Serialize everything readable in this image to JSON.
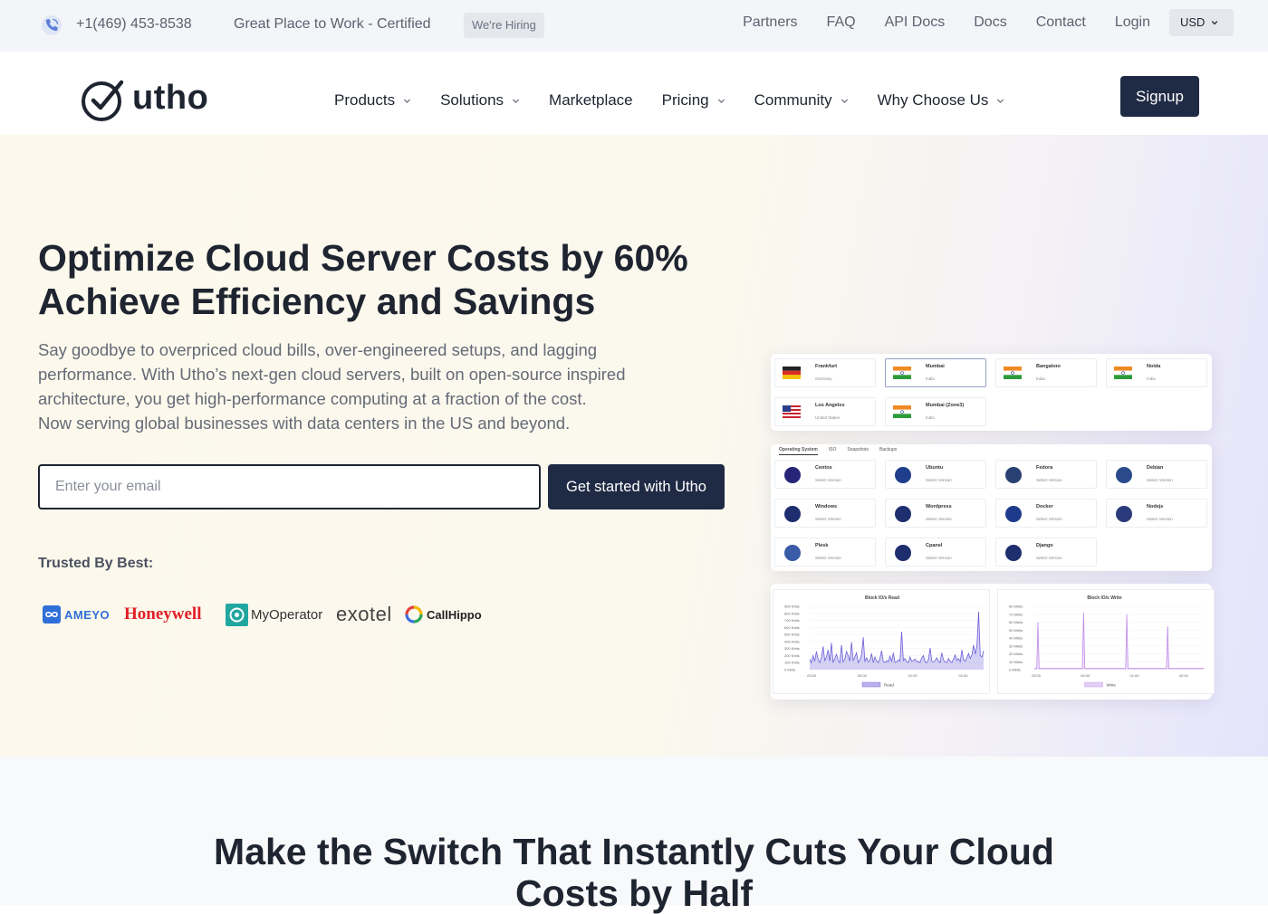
{
  "topbar": {
    "phone": "+1(469) 453-8538",
    "certification": "Great Place to Work - Certified",
    "hiring_badge": "We're Hiring",
    "links": [
      "Partners",
      "FAQ",
      "API Docs",
      "Docs",
      "Contact",
      "Login"
    ],
    "currency": "USD"
  },
  "nav": {
    "logo": "utho",
    "menu": [
      {
        "label": "Products",
        "dropdown": true
      },
      {
        "label": "Solutions",
        "dropdown": true
      },
      {
        "label": "Marketplace",
        "dropdown": false
      },
      {
        "label": "Pricing",
        "dropdown": true
      },
      {
        "label": "Community",
        "dropdown": true
      },
      {
        "label": "Why Choose Us",
        "dropdown": true
      }
    ],
    "signup": "Signup"
  },
  "hero": {
    "title_line1": "Optimize Cloud Server Costs by 60%",
    "title_line2": "Achieve Efficiency and Savings",
    "lead_line1": "Say goodbye to overpriced cloud bills, over-engineered setups, and lagging",
    "lead_line2": "performance. With Utho’s next-gen cloud servers, built on open-source inspired",
    "lead_line3": "architecture, you get high-performance computing at a fraction of the cost.",
    "lead_line4": "Now serving global businesses with data centers in the US and beyond.",
    "email_placeholder": "Enter your email",
    "cta": "Get started with Utho",
    "trusted": "Trusted By Best:",
    "brands": [
      "AMEYO",
      "Honeywell",
      "MyOperator",
      "exotel",
      "CallHippo"
    ]
  },
  "preview": {
    "locations": [
      {
        "city": "Frankfurt",
        "country": "Germany",
        "flag": "de"
      },
      {
        "city": "Mumbai",
        "country": "India",
        "flag": "in",
        "selected": true
      },
      {
        "city": "Bangalore",
        "country": "India",
        "flag": "in"
      },
      {
        "city": "Noida",
        "country": "India",
        "flag": "in"
      },
      {
        "city": "Los Angeles",
        "country": "United States",
        "flag": "us"
      },
      {
        "city": "Mumbai (Zone3)",
        "country": "India",
        "flag": "in"
      }
    ],
    "os_tabs": [
      "Operating System",
      "ISO",
      "Snapshots",
      "Backups"
    ],
    "os_items": [
      {
        "name": "Centos",
        "sub": "Select Version",
        "icon": "centos-icon",
        "color": "#262577"
      },
      {
        "name": "Ubuntu",
        "sub": "Select Version",
        "icon": "ubuntu-icon",
        "color": "#1f3d8a"
      },
      {
        "name": "Fedora",
        "sub": "Select Version",
        "icon": "fedora-icon",
        "color": "#294172"
      },
      {
        "name": "Debian",
        "sub": "Select Version",
        "icon": "debian-icon",
        "color": "#2a4a8c"
      },
      {
        "name": "Windows",
        "sub": "Select Version",
        "icon": "windows-icon",
        "color": "#1e2e6e"
      },
      {
        "name": "Wordpress",
        "sub": "Select Version",
        "icon": "wordpress-icon",
        "color": "#1e2e6e"
      },
      {
        "name": "Docker",
        "sub": "Select Version",
        "icon": "docker-icon",
        "color": "#1e3a8a"
      },
      {
        "name": "Nodejs",
        "sub": "Select Version",
        "icon": "nodejs-icon",
        "color": "#2a3a7a"
      },
      {
        "name": "Plesk",
        "sub": "Select Version",
        "icon": "plesk-icon",
        "color": "#3a5ba8"
      },
      {
        "name": "Cpanel",
        "sub": "Select Version",
        "icon": "cpanel-icon",
        "color": "#1e2e6e"
      },
      {
        "name": "Django",
        "sub": "Select Version",
        "icon": "django-icon",
        "color": "#1e2e6e"
      }
    ],
    "charts": [
      {
        "title": "Block IO/s Read",
        "legend": "Read",
        "yticks": [
          "900 Kbits",
          "800 Kbits",
          "700 Kbits",
          "600 Kbits",
          "500 Kbits",
          "400 Kbits",
          "300 Kbits",
          "200 Kbits",
          "100 Kbits",
          "0 Kbits"
        ],
        "xticks": [
          "23:00",
          "00:00",
          "01:00",
          "02:00"
        ],
        "line": "#6d5fd8",
        "fill": "#b9b2ee",
        "values": [
          1.5,
          1,
          2,
          1.2,
          2.6,
          1.5,
          1,
          1.7,
          3.3,
          1.3,
          1.8,
          2.8,
          1.2,
          3.8,
          1,
          1.6,
          2.2,
          1.3,
          1,
          3.5,
          1.1,
          1.5,
          2.6,
          2,
          1.2,
          3.9,
          1.3,
          1.8,
          2.4,
          1,
          1.4,
          2.1,
          4.6,
          1.2,
          1.7,
          1.1,
          1.3,
          2.3,
          1,
          1.8,
          1.2,
          1,
          1.6,
          2.7,
          1.2,
          1,
          1.3,
          1.1,
          1.9,
          1.2,
          2.4,
          1,
          1.1,
          1.4,
          1.2,
          5.4,
          1.3,
          1.6,
          1.1,
          1,
          1.8,
          1.2,
          1.3,
          1.5,
          1.1,
          1.2,
          1,
          1.7,
          2,
          1.1,
          1,
          1.4,
          3.1,
          1.2,
          1.1,
          1.3,
          1.7,
          1.2,
          1,
          2.4,
          1.4,
          1.1,
          1,
          1.6,
          1.2,
          1,
          1.5,
          2.1,
          1.3,
          1.6,
          1.1,
          2.8,
          1.4,
          1.2,
          1.7,
          2.3,
          1.6,
          2.1,
          3.5,
          2.2,
          3.4,
          8.2,
          2,
          1.8,
          2.7
        ]
      },
      {
        "title": "Block IO/s Write",
        "legend": "Write",
        "yticks": [
          "80 Mbits",
          "70 Mbits",
          "60 Mbits",
          "50 Mbits",
          "40 Mbits",
          "30 Mbits",
          "20 Mbits",
          "10 Mbits",
          "0 Mbits"
        ],
        "xticks": [
          "23:00",
          "00:00",
          "01:00",
          "02:00"
        ],
        "line": "#c08ae8",
        "fill": "#e4cff6",
        "values": [
          1.5,
          1.5,
          1.5,
          60,
          1.5,
          1.5,
          1.5,
          1.5,
          1.5,
          1.5,
          1.5,
          1.5,
          1.5,
          1.5,
          1.5,
          1.5,
          1.5,
          1.5,
          1.5,
          1.5,
          1.5,
          1.5,
          1.5,
          1.5,
          1.5,
          1.5,
          1.5,
          1.5,
          1.5,
          1.5,
          1.5,
          1.5,
          1.5,
          1.5,
          1.5,
          1.5,
          1.5,
          1.5,
          1.5,
          1.5,
          1.5,
          72,
          1.5,
          1.5,
          1.5,
          1.5,
          1.5,
          1.5,
          1.5,
          1.5,
          1.5,
          1.5,
          1.5,
          1.5,
          1.5,
          1.5,
          1.5,
          1.5,
          1.5,
          1.5,
          1.5,
          1.5,
          1.5,
          1.5,
          1.5,
          1.5,
          1.5,
          1.5,
          1.5,
          1.5,
          1.5,
          1.5,
          1.5,
          1.5,
          1.5,
          1.5,
          1.5,
          70,
          1.5,
          1.5,
          1.5,
          1.5,
          1.5,
          1.5,
          1.5,
          1.5,
          1.5,
          1.5,
          1.5,
          1.5,
          1.5,
          1.5,
          1.5,
          1.5,
          1.5,
          1.5,
          1.5,
          1.5,
          1.5,
          1.5,
          1.5,
          1.5,
          1.5,
          1.5,
          1.5,
          1.5,
          1.5,
          1.5,
          1.5,
          1.5,
          1.5,
          55,
          1.5,
          1.5,
          1.5,
          1.5,
          1.5,
          1.5,
          1.5,
          1.5,
          1.5,
          1.5,
          1.5,
          1.5,
          1.5,
          1.5,
          1.5,
          1.5,
          1.5,
          1.5,
          1.5,
          1.5,
          1.5,
          1.5,
          1.5,
          1.5,
          1.5,
          1.5,
          1.5,
          1.5,
          1.5,
          1.5
        ]
      }
    ]
  },
  "section2": {
    "title_line1": "Make the Switch That Instantly Cuts Your Cloud",
    "title_line2": "Costs by Half"
  },
  "colors": {
    "brand_navy": "#1f2a44",
    "text_dark": "#1e2430",
    "text_muted": "#646a76"
  }
}
